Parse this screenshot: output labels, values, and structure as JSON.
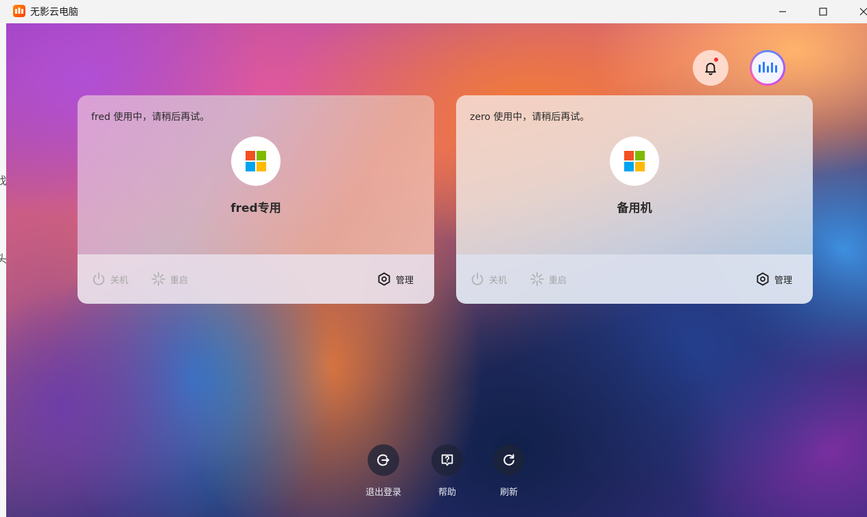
{
  "window": {
    "title": "无影云电脑",
    "buttons": {
      "minimize": "minimize",
      "maximize": "maximize",
      "close": "close"
    }
  },
  "background_window": {
    "chars": [
      "找",
      "头"
    ]
  },
  "header": {
    "notification": {
      "icon": "bell-icon",
      "has_unread": true
    },
    "assistant": {
      "icon": "voice-wave-icon"
    }
  },
  "cards": [
    {
      "status": "fred 使用中，请稍后再试。",
      "name": "fred专用",
      "os_icon": "windows-logo-icon",
      "actions": {
        "power": {
          "label": "关机",
          "enabled": false
        },
        "restart": {
          "label": "重启",
          "enabled": false
        },
        "manage": {
          "label": "管理",
          "enabled": true
        }
      }
    },
    {
      "status": "zero 使用中，请稍后再试。",
      "name": "备用机",
      "os_icon": "windows-logo-icon",
      "actions": {
        "power": {
          "label": "关机",
          "enabled": false
        },
        "restart": {
          "label": "重启",
          "enabled": false
        },
        "manage": {
          "label": "管理",
          "enabled": true
        }
      }
    }
  ],
  "dock": {
    "logout": {
      "label": "退出登录",
      "icon": "logout-icon"
    },
    "help": {
      "label": "帮助",
      "icon": "help-icon"
    },
    "refresh": {
      "label": "刷新",
      "icon": "refresh-icon"
    }
  },
  "colors": {
    "accent_orange": "#ff6a00",
    "notification_dot": "#ff2a2a",
    "windows_red": "#f25022",
    "windows_green": "#7fba00",
    "windows_blue": "#00a4ef",
    "windows_yellow": "#ffb900"
  }
}
